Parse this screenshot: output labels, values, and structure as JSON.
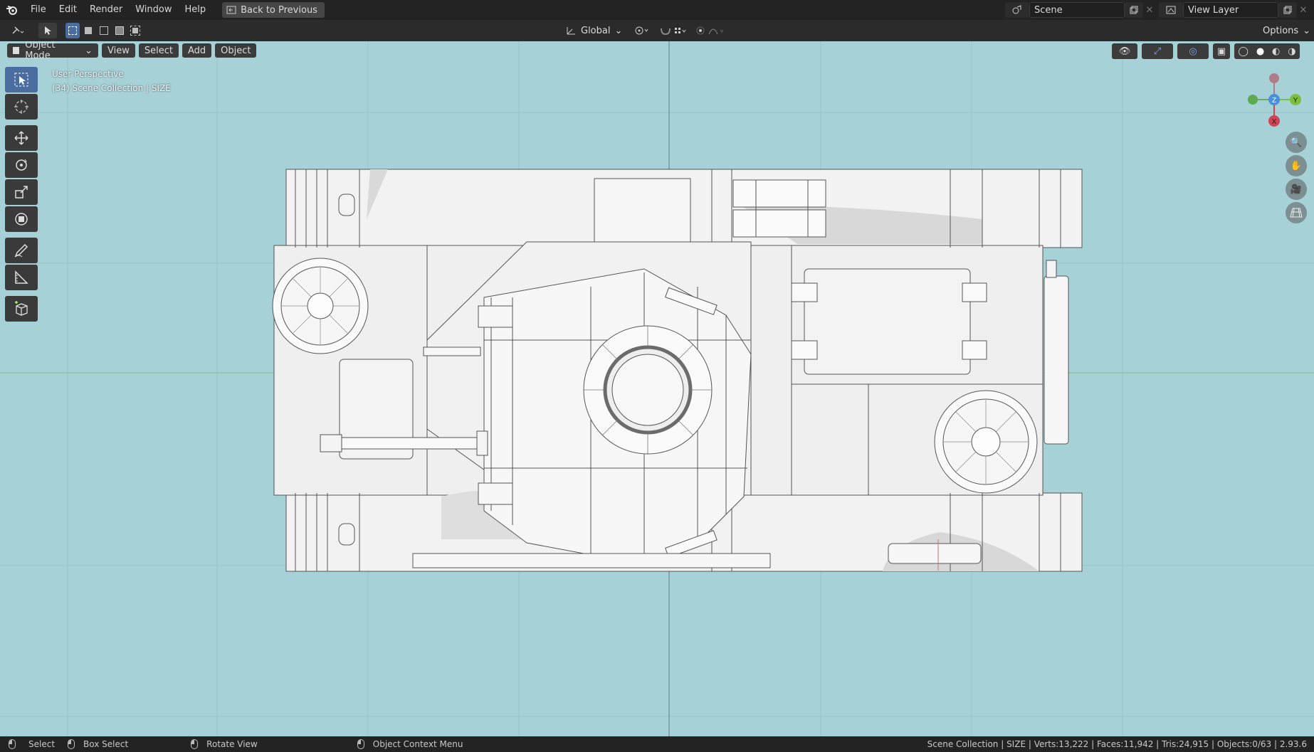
{
  "menu": {
    "items": [
      "File",
      "Edit",
      "Render",
      "Window",
      "Help"
    ],
    "back_label": "Back to Previous"
  },
  "scene": {
    "name": "Scene",
    "view_layer": "View Layer"
  },
  "header": {
    "transform_orientation": "Global",
    "options_label": "Options"
  },
  "viewport_header": {
    "mode": "Object Mode",
    "view": "View",
    "select": "Select",
    "add": "Add",
    "object": "Object"
  },
  "viewport": {
    "perspective": "User Perspective",
    "collection_info": "(34) Scene Collection | SIZE"
  },
  "gizmo": {
    "x": "X",
    "y": "Y",
    "z": "Z"
  },
  "toolbar": {
    "tools": [
      "select-box",
      "cursor",
      "move",
      "rotate",
      "scale",
      "transform",
      "annotate",
      "measure",
      "add-cube"
    ]
  },
  "status": {
    "select": "Select",
    "box_select": "Box Select",
    "rotate_view": "Rotate View",
    "context_menu": "Object Context Menu",
    "stats": "Scene Collection | SIZE | Verts:13,222 | Faces:11,942 | Tris:24,915 | Objects:0/63 | 2.93.6"
  },
  "colors": {
    "viewport_bg": "#a6d1d7",
    "axis_x": "#d04455",
    "axis_y": "#7bbf3e",
    "axis_z": "#4a8fd8",
    "active_tool": "#4a6c9f"
  }
}
